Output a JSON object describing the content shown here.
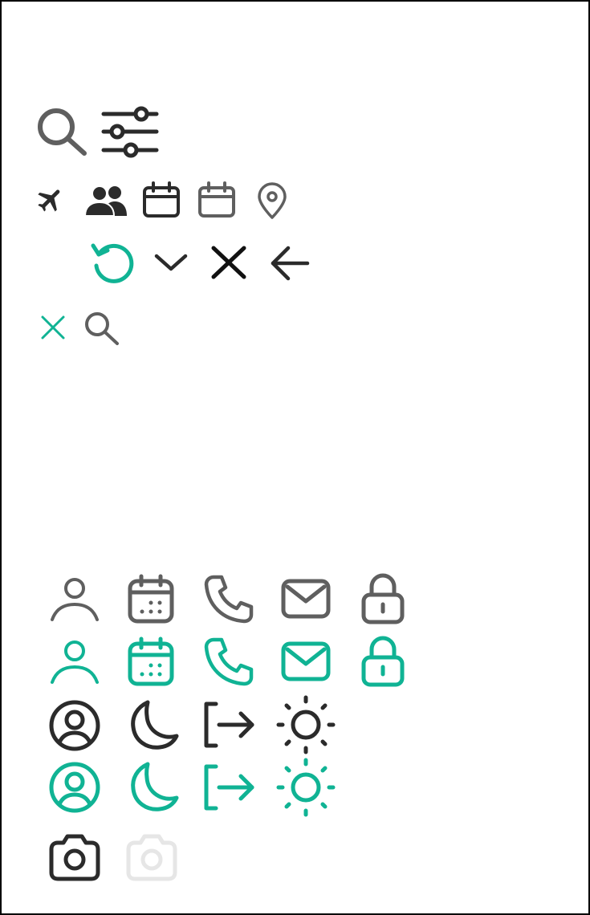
{
  "colors": {
    "gray": "#5f5f5f",
    "dark": "#2b2b2b",
    "black": "#111111",
    "teal": "#10b394",
    "disabled": "#e6e6e6",
    "border": "#000000",
    "background": "#ffffff"
  },
  "icon_sheet": {
    "top_group": {
      "row1": [
        "search-icon",
        "sliders-filter-icon"
      ],
      "row2": [
        "airplane-icon",
        "users-icon",
        "calendar-icon",
        "calendar-icon",
        "map-pin-icon"
      ],
      "row3": [
        "refresh-icon",
        "chevron-down-icon",
        "close-icon",
        "arrow-left-icon"
      ],
      "row4": [
        "close-icon",
        "search-icon"
      ]
    },
    "bottom_group": {
      "row1_gray": [
        "user-icon",
        "calendar-icon",
        "phone-icon",
        "mail-icon",
        "lock-icon"
      ],
      "row2_teal": [
        "user-icon",
        "calendar-icon",
        "phone-icon",
        "mail-icon",
        "lock-icon"
      ],
      "row3_dark": [
        "user-circle-icon",
        "moon-icon",
        "logout-icon",
        "sun-icon"
      ],
      "row4_teal": [
        "user-circle-icon",
        "moon-icon",
        "logout-icon",
        "sun-icon"
      ],
      "row5": [
        "camera-icon",
        "camera-disabled-icon"
      ]
    }
  }
}
